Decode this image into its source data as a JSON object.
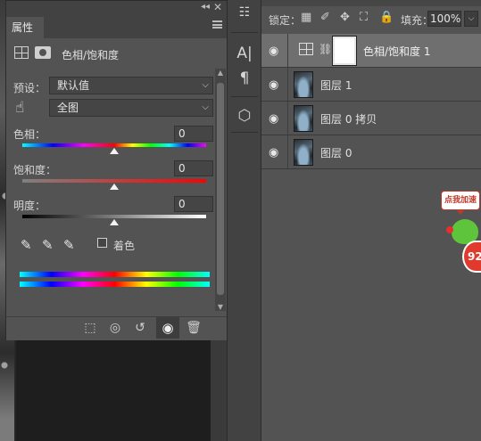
{
  "properties_panel": {
    "tab_label": "属性",
    "adjustment_title": "色相/饱和度",
    "preset": {
      "label": "预设：",
      "value": "默认值"
    },
    "channel": {
      "value": "全图"
    },
    "hue": {
      "label": "色相：",
      "value": "0"
    },
    "saturation": {
      "label": "饱和度：",
      "value": "0"
    },
    "lightness": {
      "label": "明度：",
      "value": "0"
    },
    "colorize_label": "着色"
  },
  "layers_panel": {
    "lock_label": "锁定：",
    "fill_label": "填充：",
    "fill_value": "100%",
    "layers": [
      {
        "name": "色相/饱和度 1",
        "type": "adjustment",
        "visible": true,
        "selected": true
      },
      {
        "name": "图层 1",
        "type": "image",
        "visible": true,
        "selected": false
      },
      {
        "name": "图层 0 拷贝",
        "type": "image",
        "visible": true,
        "selected": false
      },
      {
        "name": "图层 0",
        "type": "image",
        "visible": true,
        "selected": false
      }
    ]
  },
  "floating_widget": {
    "bubble_text": "点我加速",
    "badge_text": "92"
  },
  "icons": {
    "toolbar": [
      "properties-icon",
      "character-icon",
      "paragraph-icon",
      "3d-icon"
    ],
    "footer": [
      "clip-icon",
      "view-previous-icon",
      "reset-icon",
      "visibility-toggle-icon",
      "delete-icon"
    ],
    "locks": [
      "lock-pixels-icon",
      "lock-paint-icon",
      "lock-move-icon",
      "lock-artboard-icon",
      "lock-all-icon"
    ]
  },
  "colors": {
    "panel_bg": "#535353",
    "dark_bg": "#424242",
    "selected_layer": "#6f6f6f",
    "badge_red": "#e03a2f",
    "mascot_green": "#5dc43b"
  }
}
